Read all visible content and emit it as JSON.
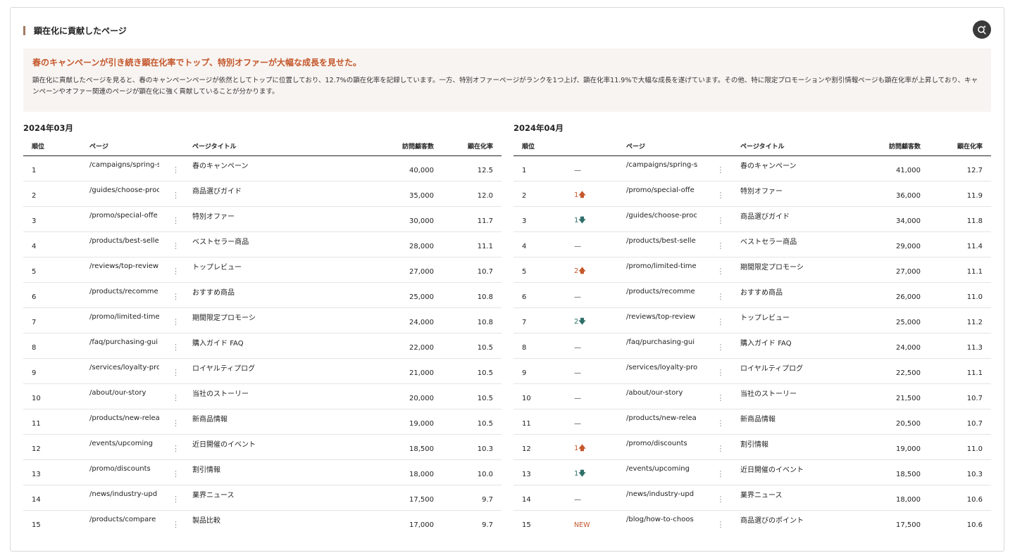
{
  "section": {
    "title": "顕在化に貢献したページ"
  },
  "summary": {
    "headline": "春のキャンペーンが引き続き顕在化率でトップ、特別オファーが大幅な成長を見せた。",
    "body": "顕在化に貢献したページを見ると、春のキャンペーンページが依然としてトップに位置しており、12.7%の顕在化率を記録しています。一方、特別オファーページがランクを1つ上げ、顕在化率11.9%で大幅な成長を遂げています。その他、特に限定プロモーションや割引情報ページも顕在化率が上昇しており、キャンペーンやオファー関連のページが顕在化に強く貢献していることが分かります。"
  },
  "colors": {
    "accent": "#a17b62",
    "headline": "#c4572b",
    "up": "#c4572b",
    "down": "#2f6f6a",
    "summary_bg": "#f8f4f1"
  },
  "icons": {
    "ai_button": "sparkle-search-icon",
    "row_menu": "vertical-ellipsis-icon"
  },
  "left": {
    "period": "2024年03月",
    "headers": {
      "rank": "順位",
      "page": "ページ",
      "title": "ページタイトル",
      "visitors": "訪問顧客数",
      "rate": "顕在化率"
    },
    "rows": [
      {
        "rank": "1",
        "page": "/campaigns/spring-s",
        "title": "春のキャンペーン",
        "visitors": "40,000",
        "rate": "12.5"
      },
      {
        "rank": "2",
        "page": "/guides/choose-proc",
        "title": "商品選びガイド",
        "visitors": "35,000",
        "rate": "12.0"
      },
      {
        "rank": "3",
        "page": "/promo/special-offe",
        "title": "特別オファー",
        "visitors": "30,000",
        "rate": "11.7"
      },
      {
        "rank": "4",
        "page": "/products/best-selle",
        "title": "ベストセラー商品",
        "visitors": "28,000",
        "rate": "11.1"
      },
      {
        "rank": "5",
        "page": "/reviews/top-review",
        "title": "トップレビュー",
        "visitors": "27,000",
        "rate": "10.7"
      },
      {
        "rank": "6",
        "page": "/products/recomme",
        "title": "おすすめ商品",
        "visitors": "25,000",
        "rate": "10.8"
      },
      {
        "rank": "7",
        "page": "/promo/limited-time",
        "title": "期間限定プロモーシ",
        "visitors": "24,000",
        "rate": "10.8"
      },
      {
        "rank": "8",
        "page": "/faq/purchasing-gui",
        "title": "購入ガイド FAQ",
        "visitors": "22,000",
        "rate": "10.5"
      },
      {
        "rank": "9",
        "page": "/services/loyalty-pro",
        "title": "ロイヤルティプログ",
        "visitors": "21,000",
        "rate": "10.5"
      },
      {
        "rank": "10",
        "page": "/about/our-story",
        "title": "当社のストーリー",
        "visitors": "20,000",
        "rate": "10.5"
      },
      {
        "rank": "11",
        "page": "/products/new-relea",
        "title": "新商品情報",
        "visitors": "19,000",
        "rate": "10.5"
      },
      {
        "rank": "12",
        "page": "/events/upcoming",
        "title": "近日開催のイベント",
        "visitors": "18,500",
        "rate": "10.3"
      },
      {
        "rank": "13",
        "page": "/promo/discounts",
        "title": "割引情報",
        "visitors": "18,000",
        "rate": "10.0"
      },
      {
        "rank": "14",
        "page": "/news/industry-upd",
        "title": "業界ニュース",
        "visitors": "17,500",
        "rate": "9.7"
      },
      {
        "rank": "15",
        "page": "/products/compare",
        "title": "製品比較",
        "visitors": "17,000",
        "rate": "9.7"
      }
    ]
  },
  "right": {
    "period": "2024年04月",
    "headers": {
      "rank": "順位",
      "page": "ページ",
      "title": "ページタイトル",
      "visitors": "訪問顧客数",
      "rate": "顕在化率"
    },
    "rows": [
      {
        "rank": "1",
        "change": "—",
        "dir": "same",
        "page": "/campaigns/spring-s",
        "title": "春のキャンペーン",
        "visitors": "41,000",
        "rate": "12.7"
      },
      {
        "rank": "2",
        "change": "1",
        "dir": "up",
        "page": "/promo/special-offe",
        "title": "特別オファー",
        "visitors": "36,000",
        "rate": "11.9"
      },
      {
        "rank": "3",
        "change": "1",
        "dir": "down",
        "page": "/guides/choose-proc",
        "title": "商品選びガイド",
        "visitors": "34,000",
        "rate": "11.8"
      },
      {
        "rank": "4",
        "change": "—",
        "dir": "same",
        "page": "/products/best-selle",
        "title": "ベストセラー商品",
        "visitors": "29,000",
        "rate": "11.4"
      },
      {
        "rank": "5",
        "change": "2",
        "dir": "up",
        "page": "/promo/limited-time",
        "title": "期間限定プロモーシ",
        "visitors": "27,000",
        "rate": "11.1"
      },
      {
        "rank": "6",
        "change": "—",
        "dir": "same",
        "page": "/products/recomme",
        "title": "おすすめ商品",
        "visitors": "26,000",
        "rate": "11.0"
      },
      {
        "rank": "7",
        "change": "2",
        "dir": "down",
        "page": "/reviews/top-review",
        "title": "トップレビュー",
        "visitors": "25,000",
        "rate": "11.2"
      },
      {
        "rank": "8",
        "change": "—",
        "dir": "same",
        "page": "/faq/purchasing-gui",
        "title": "購入ガイド FAQ",
        "visitors": "24,000",
        "rate": "11.3"
      },
      {
        "rank": "9",
        "change": "—",
        "dir": "same",
        "page": "/services/loyalty-pro",
        "title": "ロイヤルティプログ",
        "visitors": "22,500",
        "rate": "11.1"
      },
      {
        "rank": "10",
        "change": "—",
        "dir": "same",
        "page": "/about/our-story",
        "title": "当社のストーリー",
        "visitors": "21,500",
        "rate": "10.7"
      },
      {
        "rank": "11",
        "change": "—",
        "dir": "same",
        "page": "/products/new-relea",
        "title": "新商品情報",
        "visitors": "20,500",
        "rate": "10.7"
      },
      {
        "rank": "12",
        "change": "1",
        "dir": "up",
        "page": "/promo/discounts",
        "title": "割引情報",
        "visitors": "19,000",
        "rate": "11.0"
      },
      {
        "rank": "13",
        "change": "1",
        "dir": "down",
        "page": "/events/upcoming",
        "title": "近日開催のイベント",
        "visitors": "18,500",
        "rate": "10.3"
      },
      {
        "rank": "14",
        "change": "—",
        "dir": "same",
        "page": "/news/industry-upd",
        "title": "業界ニュース",
        "visitors": "18,000",
        "rate": "10.6"
      },
      {
        "rank": "15",
        "change": "NEW",
        "dir": "new",
        "page": "/blog/how-to-choos",
        "title": "商品選びのポイント",
        "visitors": "17,500",
        "rate": "10.6"
      }
    ]
  }
}
